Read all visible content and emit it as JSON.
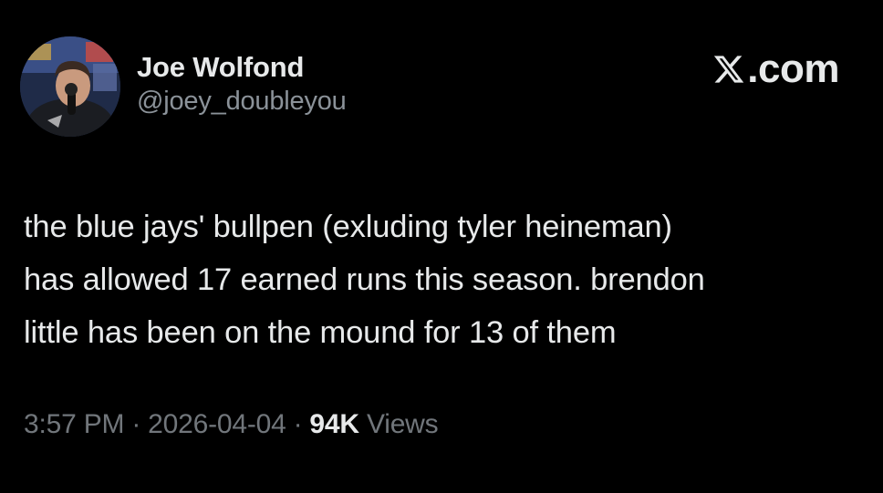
{
  "author": {
    "display_name": "Joe Wolfond",
    "handle": "@joey_doubleyou",
    "avatar_icon": "profile-photo"
  },
  "brand": {
    "logo_icon": "x-logo-icon",
    "domain": ".com"
  },
  "tweet": {
    "lines": [
      "the blue jays' bullpen (exluding tyler heineman)",
      "has allowed 17 earned runs this season. brendon",
      "little has been on the mound for 13 of them"
    ]
  },
  "meta": {
    "time": "3:57 PM",
    "separator": "·",
    "date": "2026-04-04",
    "view_count": "94K",
    "views_label": "Views"
  },
  "colors": {
    "background": "#000000",
    "primary_text": "#e7e9ea",
    "secondary_text": "#71767b"
  }
}
